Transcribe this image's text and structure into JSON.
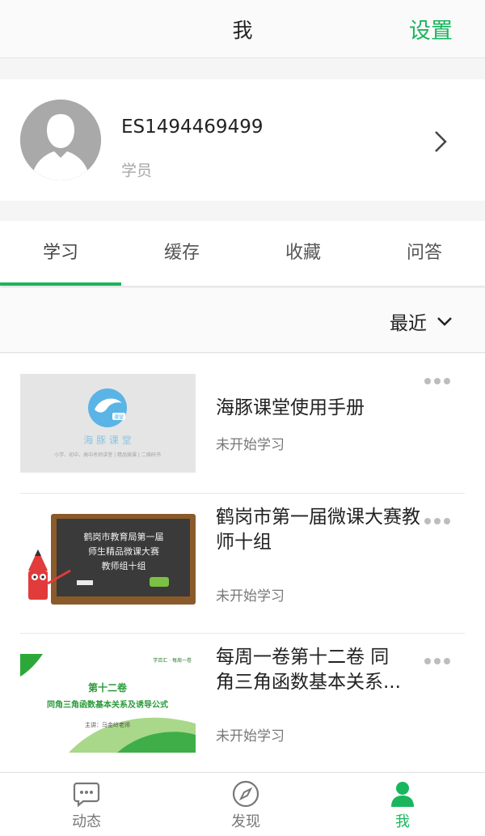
{
  "header": {
    "title": "我",
    "settings_label": "设置"
  },
  "profile": {
    "username": "ES1494469499",
    "role": "学员"
  },
  "tabs": [
    {
      "label": "学习",
      "active": true
    },
    {
      "label": "缓存",
      "active": false
    },
    {
      "label": "收藏",
      "active": false
    },
    {
      "label": "问答",
      "active": false
    }
  ],
  "sort": {
    "label": "最近"
  },
  "courses": [
    {
      "title": "海豚课堂使用手册",
      "status": "未开始学习",
      "thumb": {
        "name": "海 豚 课 堂",
        "tagline": "小学、初中、高中名师讲堂 | 精品微课 | 二维码书",
        "badge": "课堂"
      }
    },
    {
      "title": "鹤岗市第一届微课大赛教师十组",
      "status": "未开始学习",
      "thumb": {
        "lines": [
          "鹤岗市教育局第一届",
          "师生精品微课大赛",
          "教师组十组"
        ]
      }
    },
    {
      "title": "每周一卷第十二卷 同角三角函数基本关系...",
      "status": "未开始学习",
      "thumb": {
        "brand": "学百汇 · 每周一卷",
        "volume": "第十二卷",
        "subtitle": "同角三角函数基本关系及诱导公式",
        "speaker": "主讲：马金岭老师"
      }
    }
  ],
  "bottom_nav": [
    {
      "label": "动态",
      "icon": "chat-icon",
      "active": false
    },
    {
      "label": "发现",
      "icon": "compass-icon",
      "active": false
    },
    {
      "label": "我",
      "icon": "person-icon",
      "active": true
    }
  ],
  "colors": {
    "accent": "#1ab65d",
    "chalkboard": "#3a3a3a"
  }
}
